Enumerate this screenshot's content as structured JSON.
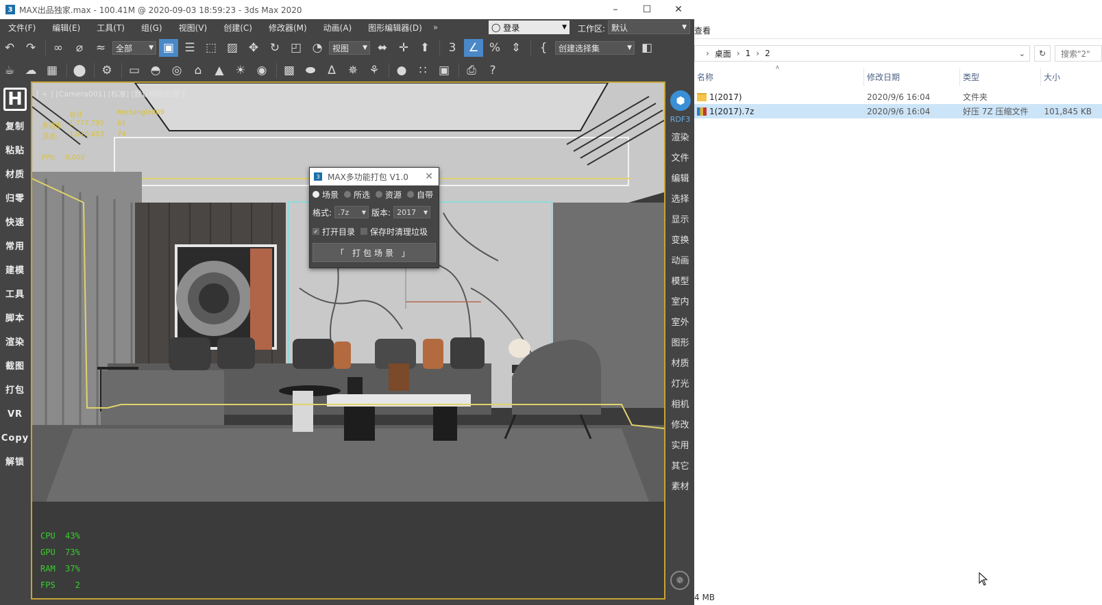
{
  "max": {
    "title": "MAX出品独家.max - 100.41M @ 2020-09-03 18:59:23 - 3ds Max 2020",
    "app_icon": "3",
    "menu": [
      "文件(F)",
      "编辑(E)",
      "工具(T)",
      "组(G)",
      "视图(V)",
      "创建(C)",
      "修改器(M)",
      "动画(A)",
      "图形编辑器(D)"
    ],
    "menu_more": "»",
    "login": "登录",
    "workspace_label": "工作区:",
    "workspace_value": "默认",
    "toolbar": {
      "filter_value": "全部",
      "view_value": "视图",
      "selection_set_placeholder": "创建选择集"
    },
    "left_rail": {
      "items": [
        "复制",
        "粘贴",
        "材质",
        "归零",
        "快速",
        "常用",
        "建模",
        "工具",
        "脚本",
        "渲染",
        "截图",
        "打包",
        "VR",
        "Copy",
        "解锁"
      ]
    },
    "right_rail": {
      "label": "RDF3",
      "items": [
        "渲染",
        "文件",
        "编辑",
        "选择",
        "显示",
        "变换",
        "动画",
        "模型",
        "室内",
        "室外",
        "图形",
        "材质",
        "灯光",
        "相机",
        "修改",
        "实用",
        "其它",
        "素材"
      ]
    },
    "viewport": {
      "label": "[ + ] [Camera001] [标准] [默认明暗处理 ]",
      "stats": {
        "header": [
          "",
          "总计",
          "Rectangle009"
        ],
        "rows": [
          [
            "多边形:",
            "1,777,792",
            "61"
          ],
          [
            "顶点:",
            "1,820,653",
            "74"
          ]
        ],
        "fps_label": "FPS:",
        "fps_value": "0.002"
      },
      "perf": [
        {
          "label": "CPU",
          "value": "43%"
        },
        {
          "label": "GPU",
          "value": "73%"
        },
        {
          "label": "RAM",
          "value": "37%"
        },
        {
          "label": "FPS",
          "value": "2"
        }
      ]
    },
    "dialog": {
      "title": "MAX多功能打包 V1.0",
      "radios": [
        {
          "label": "场景",
          "checked": true
        },
        {
          "label": "所选",
          "checked": false
        },
        {
          "label": "资源",
          "checked": false
        },
        {
          "label": "自带",
          "checked": false
        }
      ],
      "format_label": "格式:",
      "format_value": ".7z",
      "version_label": "版本:",
      "version_value": "2017",
      "open_dir_label": "打开目录",
      "clean_label": "保存时清理垃圾",
      "pack_button": "「 打包场景 」"
    }
  },
  "explorer": {
    "view_tab": "查看",
    "breadcrumb": [
      "桌面",
      "1",
      "2"
    ],
    "search_placeholder": "搜索\"2\"",
    "columns": [
      "名称",
      "修改日期",
      "类型",
      "大小"
    ],
    "files": [
      {
        "name": "1(2017)",
        "date": "2020/9/6 16:04",
        "type": "文件夹",
        "size": "",
        "kind": "folder"
      },
      {
        "name": "1(2017).7z",
        "date": "2020/9/6 16:04",
        "type": "好压 7Z 压缩文件",
        "size": "101,845 KB",
        "kind": "zip",
        "selected": true
      }
    ],
    "status": "4 MB"
  }
}
